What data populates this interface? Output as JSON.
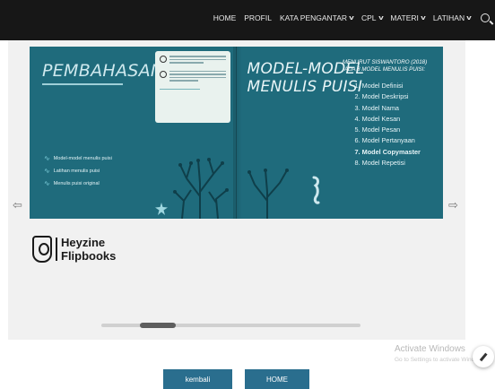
{
  "nav": {
    "items": [
      {
        "label": "HOME",
        "dropdown": false
      },
      {
        "label": "PROFIL",
        "dropdown": false
      },
      {
        "label": "KATA PENGANTAR",
        "dropdown": true
      },
      {
        "label": "CPL",
        "dropdown": true
      },
      {
        "label": "MATERI",
        "dropdown": true
      },
      {
        "label": "LATIHAN",
        "dropdown": true
      }
    ],
    "search_icon": "search-icon"
  },
  "flipbook": {
    "left_page": {
      "title": "PEMBAHASAN:",
      "topics": [
        "Model-model menulis puisi",
        "Latihan menulis puisi",
        "Menulis puisi original"
      ]
    },
    "right_page": {
      "title_line1": "MODEL-MODEL",
      "title_line2": "MENULIS PUISI",
      "subtitle_line1": "MENURUT SISWANTORO (2018)",
      "subtitle_line2": "ADA 8 MODEL MENULIS PUISI:",
      "models": [
        "1. Model Definisi",
        "2. Model Deskripsi",
        "3. Model Nama",
        "4. Model Kesan",
        "5. Model Pesan",
        "6. Model Pertanyaan",
        "7. Model Copymaster",
        "8. Model Repetisi"
      ]
    },
    "prev_arrow": "⇦",
    "next_arrow": "⇨",
    "brand_line1": "Heyzine",
    "brand_line2": "Flipbooks"
  },
  "watermark": {
    "title": "Activate Windows",
    "subtitle": "Go to Settings to activate Windows."
  },
  "buttons": {
    "back": "kembali",
    "home": "HOME"
  },
  "colors": {
    "nav_bg": "#171717",
    "page_bg": "#1f6b7c",
    "button_bg": "#2a6e8e"
  }
}
